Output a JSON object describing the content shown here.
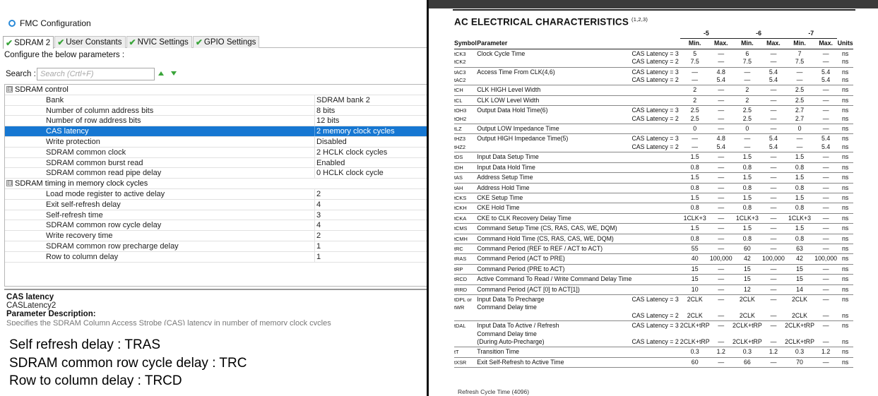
{
  "cubemx": {
    "title": "FMC Configuration",
    "tabs": [
      "SDRAM 2",
      "User Constants",
      "NVIC Settings",
      "GPIO Settings"
    ],
    "hint": "Configure the below parameters :",
    "search_label": "Search :",
    "search_placeholder": "Search (Crtl+F)",
    "groups": [
      {
        "label": "SDRAM control",
        "expander": "⊟",
        "params": [
          {
            "name": "Bank",
            "value": "SDRAM bank 2"
          },
          {
            "name": "Number of column address bits",
            "value": "8 bits"
          },
          {
            "name": "Number of row address bits",
            "value": "12 bits"
          },
          {
            "name": "CAS latency",
            "value": "2 memory clock cycles",
            "selected": true
          },
          {
            "name": "Write protection",
            "value": "Disabled"
          },
          {
            "name": "SDRAM common clock",
            "value": "2 HCLK clock cycles"
          },
          {
            "name": "SDRAM common burst read",
            "value": "Enabled"
          },
          {
            "name": "SDRAM common read pipe delay",
            "value": "0 HCLK clock cycle"
          }
        ]
      },
      {
        "label": "SDRAM timing in memory clock cycles",
        "expander": "⊟",
        "params": [
          {
            "name": "Load mode register to active delay",
            "value": "2"
          },
          {
            "name": "Exit self-refresh delay",
            "value": "4"
          },
          {
            "name": "Self-refresh time",
            "value": "3"
          },
          {
            "name": "SDRAM common row cycle delay",
            "value": "4"
          },
          {
            "name": "Write recovery time",
            "value": "2"
          },
          {
            "name": "SDRAM common row precharge delay",
            "value": "1"
          },
          {
            "name": "Row to column delay",
            "value": "1"
          }
        ]
      }
    ],
    "description": {
      "title": "CAS latency",
      "subtitle": "CASLatency2",
      "heading": "Parameter Description:",
      "cut_text": "Specifies the SDRAM Column Access Strobe (CAS) latency in number of memory clock cycles"
    }
  },
  "notes": [
    "Self refresh delay : TRAS",
    "SDRAM common row cycle delay : TRC",
    "Row to column delay : TRCD"
  ],
  "datasheet": {
    "heading": "AC ELECTRICAL CHARACTERISTICS",
    "heading_refs": "(1,2,3)",
    "speed_grades": [
      "-5",
      "-6",
      "-7"
    ],
    "columns": [
      "Symbol",
      "Parameter",
      "Min.",
      "Max.",
      "Min.",
      "Max.",
      "Min.",
      "Max.",
      "Units"
    ],
    "rows": [
      {
        "sym": [
          "tCK3",
          "tCK2"
        ],
        "param": [
          "Clock Cycle Time"
        ],
        "cond": [
          "CAS Latency = 3",
          "CAS Latency = 2"
        ],
        "v": [
          [
            "5",
            "7.5"
          ],
          [
            "—",
            "—"
          ],
          [
            "6",
            "7.5"
          ],
          [
            "—",
            "—"
          ],
          [
            "7",
            "7.5"
          ],
          [
            "—",
            "—"
          ]
        ],
        "unit": [
          "ns",
          "ns"
        ]
      },
      {
        "sym": [
          "tAC3",
          "tAC2"
        ],
        "param": [
          "Access Time From CLK(4,6)"
        ],
        "cond": [
          "CAS Latency = 3",
          "CAS Latency = 2"
        ],
        "v": [
          [
            "—",
            "—"
          ],
          [
            "4.8",
            "5.4"
          ],
          [
            "—",
            "—"
          ],
          [
            "5.4",
            "5.4"
          ],
          [
            "—",
            "—"
          ],
          [
            "5.4",
            "5.4"
          ]
        ],
        "unit": [
          "ns",
          "ns"
        ]
      },
      {
        "sym": [
          "tCH"
        ],
        "param": [
          "CLK HIGH Level Width"
        ],
        "cond": [
          ""
        ],
        "v": [
          [
            "2"
          ],
          [
            "—"
          ],
          [
            "2"
          ],
          [
            "—"
          ],
          [
            "2.5"
          ],
          [
            "—"
          ]
        ],
        "unit": [
          "ns"
        ]
      },
      {
        "sym": [
          "tCL"
        ],
        "param": [
          "CLK LOW Level Width"
        ],
        "cond": [
          ""
        ],
        "v": [
          [
            "2"
          ],
          [
            "—"
          ],
          [
            "2"
          ],
          [
            "—"
          ],
          [
            "2.5"
          ],
          [
            "—"
          ]
        ],
        "unit": [
          "ns"
        ]
      },
      {
        "sym": [
          "tOH3",
          "tOH2"
        ],
        "param": [
          "Output Data Hold Time(6)"
        ],
        "cond": [
          "CAS Latency = 3",
          "CAS Latency = 2"
        ],
        "v": [
          [
            "2.5",
            "2.5"
          ],
          [
            "—",
            "—"
          ],
          [
            "2.5",
            "2.5"
          ],
          [
            "—",
            "—"
          ],
          [
            "2.7",
            "2.7"
          ],
          [
            "—",
            "—"
          ]
        ],
        "unit": [
          "ns",
          "ns"
        ]
      },
      {
        "sym": [
          "tLZ"
        ],
        "param": [
          "Output LOW Impedance Time"
        ],
        "cond": [
          ""
        ],
        "v": [
          [
            "0"
          ],
          [
            "—"
          ],
          [
            "0"
          ],
          [
            "—"
          ],
          [
            "0"
          ],
          [
            "—"
          ]
        ],
        "unit": [
          "ns"
        ]
      },
      {
        "sym": [
          "tHZ3",
          "tHZ2"
        ],
        "param": [
          "Output HIGH Impedance Time(5)"
        ],
        "cond": [
          "CAS Latency = 3",
          "CAS Latency = 2"
        ],
        "v": [
          [
            "—",
            "—"
          ],
          [
            "4.8",
            "5.4"
          ],
          [
            "—",
            "—"
          ],
          [
            "5.4",
            "5.4"
          ],
          [
            "—",
            "—"
          ],
          [
            "5.4",
            "5.4"
          ]
        ],
        "unit": [
          "ns",
          "ns"
        ]
      },
      {
        "sym": [
          "tDS"
        ],
        "param": [
          "Input Data Setup Time"
        ],
        "cond": [
          ""
        ],
        "v": [
          [
            "1.5"
          ],
          [
            "—"
          ],
          [
            "1.5"
          ],
          [
            "—"
          ],
          [
            "1.5"
          ],
          [
            "—"
          ]
        ],
        "unit": [
          "ns"
        ]
      },
      {
        "sym": [
          "tDH"
        ],
        "param": [
          "Input Data Hold Time"
        ],
        "cond": [
          ""
        ],
        "v": [
          [
            "0.8"
          ],
          [
            "—"
          ],
          [
            "0.8"
          ],
          [
            "—"
          ],
          [
            "0.8"
          ],
          [
            "—"
          ]
        ],
        "unit": [
          "ns"
        ]
      },
      {
        "sym": [
          "tAS"
        ],
        "param": [
          "Address Setup Time"
        ],
        "cond": [
          ""
        ],
        "v": [
          [
            "1.5"
          ],
          [
            "—"
          ],
          [
            "1.5"
          ],
          [
            "—"
          ],
          [
            "1.5"
          ],
          [
            "—"
          ]
        ],
        "unit": [
          "ns"
        ]
      },
      {
        "sym": [
          "tAH"
        ],
        "param": [
          "Address Hold Time"
        ],
        "cond": [
          ""
        ],
        "v": [
          [
            "0.8"
          ],
          [
            "—"
          ],
          [
            "0.8"
          ],
          [
            "—"
          ],
          [
            "0.8"
          ],
          [
            "—"
          ]
        ],
        "unit": [
          "ns"
        ]
      },
      {
        "sym": [
          "tCKS"
        ],
        "param": [
          "CKE Setup Time"
        ],
        "cond": [
          ""
        ],
        "v": [
          [
            "1.5"
          ],
          [
            "—"
          ],
          [
            "1.5"
          ],
          [
            "—"
          ],
          [
            "1.5"
          ],
          [
            "—"
          ]
        ],
        "unit": [
          "ns"
        ]
      },
      {
        "sym": [
          "tCKH"
        ],
        "param": [
          "CKE Hold Time"
        ],
        "cond": [
          ""
        ],
        "v": [
          [
            "0.8"
          ],
          [
            "—"
          ],
          [
            "0.8"
          ],
          [
            "—"
          ],
          [
            "0.8"
          ],
          [
            "—"
          ]
        ],
        "unit": [
          "ns"
        ]
      },
      {
        "sym": [
          "tCKA"
        ],
        "param": [
          "CKE to CLK Recovery Delay Time"
        ],
        "cond": [
          ""
        ],
        "v": [
          [
            "1CLK+3"
          ],
          [
            "—"
          ],
          [
            "1CLK+3"
          ],
          [
            "—"
          ],
          [
            "1CLK+3"
          ],
          [
            "—"
          ]
        ],
        "unit": [
          "ns"
        ]
      },
      {
        "sym": [
          "tCMS"
        ],
        "param": [
          "Command Setup Time (CS, RAS, CAS, WE, DQM)"
        ],
        "cond": [
          ""
        ],
        "v": [
          [
            "1.5"
          ],
          [
            "—"
          ],
          [
            "1.5"
          ],
          [
            "—"
          ],
          [
            "1.5"
          ],
          [
            "—"
          ]
        ],
        "unit": [
          "ns"
        ]
      },
      {
        "sym": [
          "tCMH"
        ],
        "param": [
          "Command Hold Time (CS, RAS, CAS, WE, DQM)"
        ],
        "cond": [
          ""
        ],
        "v": [
          [
            "0.8"
          ],
          [
            "—"
          ],
          [
            "0.8"
          ],
          [
            "—"
          ],
          [
            "0.8"
          ],
          [
            "—"
          ]
        ],
        "unit": [
          "ns"
        ]
      },
      {
        "sym": [
          "tRC"
        ],
        "param": [
          "Command Period (REF to REF / ACT to ACT)"
        ],
        "cond": [
          ""
        ],
        "v": [
          [
            "55"
          ],
          [
            "—"
          ],
          [
            "60"
          ],
          [
            "—"
          ],
          [
            "63"
          ],
          [
            "—"
          ]
        ],
        "unit": [
          "ns"
        ]
      },
      {
        "sym": [
          "tRAS"
        ],
        "param": [
          "Command Period (ACT to PRE)"
        ],
        "cond": [
          ""
        ],
        "v": [
          [
            "40"
          ],
          [
            "100,000"
          ],
          [
            "42"
          ],
          [
            "100,000"
          ],
          [
            "42"
          ],
          [
            "100,000"
          ]
        ],
        "unit": [
          "ns"
        ]
      },
      {
        "sym": [
          "tRP"
        ],
        "param": [
          "Command Period (PRE to ACT)"
        ],
        "cond": [
          ""
        ],
        "v": [
          [
            "15"
          ],
          [
            "—"
          ],
          [
            "15"
          ],
          [
            "—"
          ],
          [
            "15"
          ],
          [
            "—"
          ]
        ],
        "unit": [
          "ns"
        ]
      },
      {
        "sym": [
          "tRCD"
        ],
        "param": [
          "Active Command To Read / Write Command Delay Time"
        ],
        "cond": [
          ""
        ],
        "v": [
          [
            "15"
          ],
          [
            "—"
          ],
          [
            "15"
          ],
          [
            "—"
          ],
          [
            "15"
          ],
          [
            "—"
          ]
        ],
        "unit": [
          "ns"
        ]
      },
      {
        "sym": [
          "tRRD"
        ],
        "param": [
          "Command Period (ACT [0] to ACT[1])"
        ],
        "cond": [
          ""
        ],
        "v": [
          [
            "10"
          ],
          [
            "—"
          ],
          [
            "12"
          ],
          [
            "—"
          ],
          [
            "14"
          ],
          [
            "—"
          ]
        ],
        "unit": [
          "ns"
        ]
      },
      {
        "sym": [
          "tDPL or",
          "tWR"
        ],
        "param": [
          "Input Data To Precharge",
          "Command Delay time"
        ],
        "cond": [
          "CAS Latency = 3",
          "",
          "CAS Latency = 2"
        ],
        "v": [
          [
            "2CLK",
            "",
            "2CLK"
          ],
          [
            "—",
            "",
            "—"
          ],
          [
            "2CLK",
            "",
            "2CLK"
          ],
          [
            "—",
            "",
            "—"
          ],
          [
            "2CLK",
            "",
            "2CLK"
          ],
          [
            "—",
            "",
            "—"
          ]
        ],
        "unit": [
          "ns",
          "",
          "ns"
        ]
      },
      {
        "sym": [
          "tDAL"
        ],
        "param": [
          "Input Data To Active / Refresh",
          "Command Delay time",
          "(During Auto-Precharge)"
        ],
        "cond": [
          "CAS Latency = 3",
          "",
          "CAS Latency = 2"
        ],
        "v": [
          [
            "2CLK+tRP",
            "",
            "2CLK+tRP"
          ],
          [
            "—",
            "",
            "—"
          ],
          [
            "2CLK+tRP",
            "",
            "2CLK+tRP"
          ],
          [
            "—",
            "",
            "—"
          ],
          [
            "2CLK+tRP",
            "",
            "2CLK+tRP"
          ],
          [
            "—",
            "",
            "—"
          ]
        ],
        "unit": [
          "ns",
          "",
          "ns"
        ]
      },
      {
        "sym": [
          "tT"
        ],
        "param": [
          "Transition Time"
        ],
        "cond": [
          ""
        ],
        "v": [
          [
            "0.3"
          ],
          [
            "1.2"
          ],
          [
            "0.3"
          ],
          [
            "1.2"
          ],
          [
            "0.3"
          ],
          [
            "1.2"
          ]
        ],
        "unit": [
          "ns"
        ]
      },
      {
        "sym": [
          "tXSR"
        ],
        "param": [
          "Exit Self-Refresh to Active Time"
        ],
        "cond": [
          ""
        ],
        "v": [
          [
            "60"
          ],
          [
            "—"
          ],
          [
            "66"
          ],
          [
            "—"
          ],
          [
            "70"
          ],
          [
            "—"
          ]
        ],
        "unit": [
          "ns"
        ]
      }
    ],
    "cut_row": "Refresh Cycle Time (4096)"
  },
  "colors": {
    "selection": "#1677d2",
    "check": "#3aa53a",
    "gear": "#2a8ad8"
  }
}
